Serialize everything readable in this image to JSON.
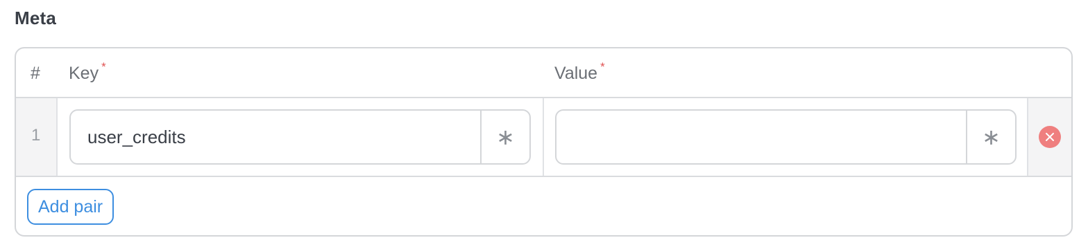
{
  "section": {
    "title": "Meta"
  },
  "table": {
    "headers": {
      "index": "#",
      "key": "Key",
      "value": "Value",
      "required_marker": "*"
    },
    "rows": [
      {
        "index": "1",
        "key": "user_credits",
        "value": "",
        "key_addon": "∗",
        "value_addon": "∗"
      }
    ]
  },
  "actions": {
    "add_pair_label": "Add pair"
  },
  "colors": {
    "accent": "#3d8ee0",
    "required": "#e05252",
    "remove": "#ef7f7f"
  }
}
